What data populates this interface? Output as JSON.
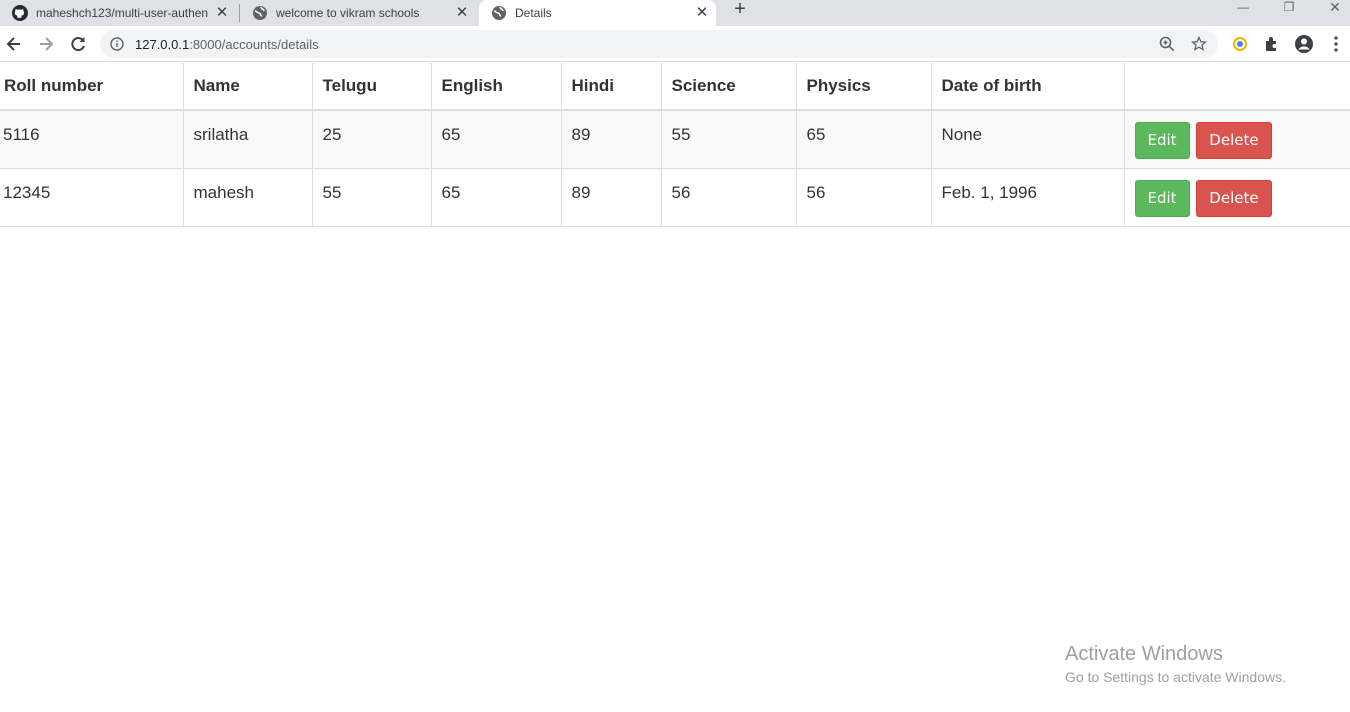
{
  "browser": {
    "tabs": [
      {
        "title": "maheshch123/multi-user-authen",
        "icon": "github-icon",
        "active": false
      },
      {
        "title": "welcome to vikram schools",
        "icon": "globe-icon",
        "active": false
      },
      {
        "title": "Details",
        "icon": "globe-icon",
        "active": true
      }
    ],
    "new_tab": "+",
    "url_host": "127.0.0.1",
    "url_rest": ":8000/accounts/details"
  },
  "table": {
    "headers": [
      "Roll number",
      "Name",
      "Telugu",
      "English",
      "Hindi",
      "Science",
      "Physics",
      "Date of birth",
      ""
    ],
    "rows": [
      {
        "roll": "5116",
        "name": "srilatha",
        "telugu": "25",
        "english": "65",
        "hindi": "89",
        "science": "55",
        "physics": "65",
        "dob": "None"
      },
      {
        "roll": "12345",
        "name": "mahesh",
        "telugu": "55",
        "english": "65",
        "hindi": "89",
        "science": "56",
        "physics": "56",
        "dob": "Feb. 1, 1996"
      }
    ],
    "edit_label": "Edit",
    "delete_label": "Delete"
  },
  "watermark": {
    "line1": "Activate Windows",
    "line2": "Go to Settings to activate Windows."
  },
  "colors": {
    "edit": "#5cb85c",
    "delete": "#d9534f"
  }
}
